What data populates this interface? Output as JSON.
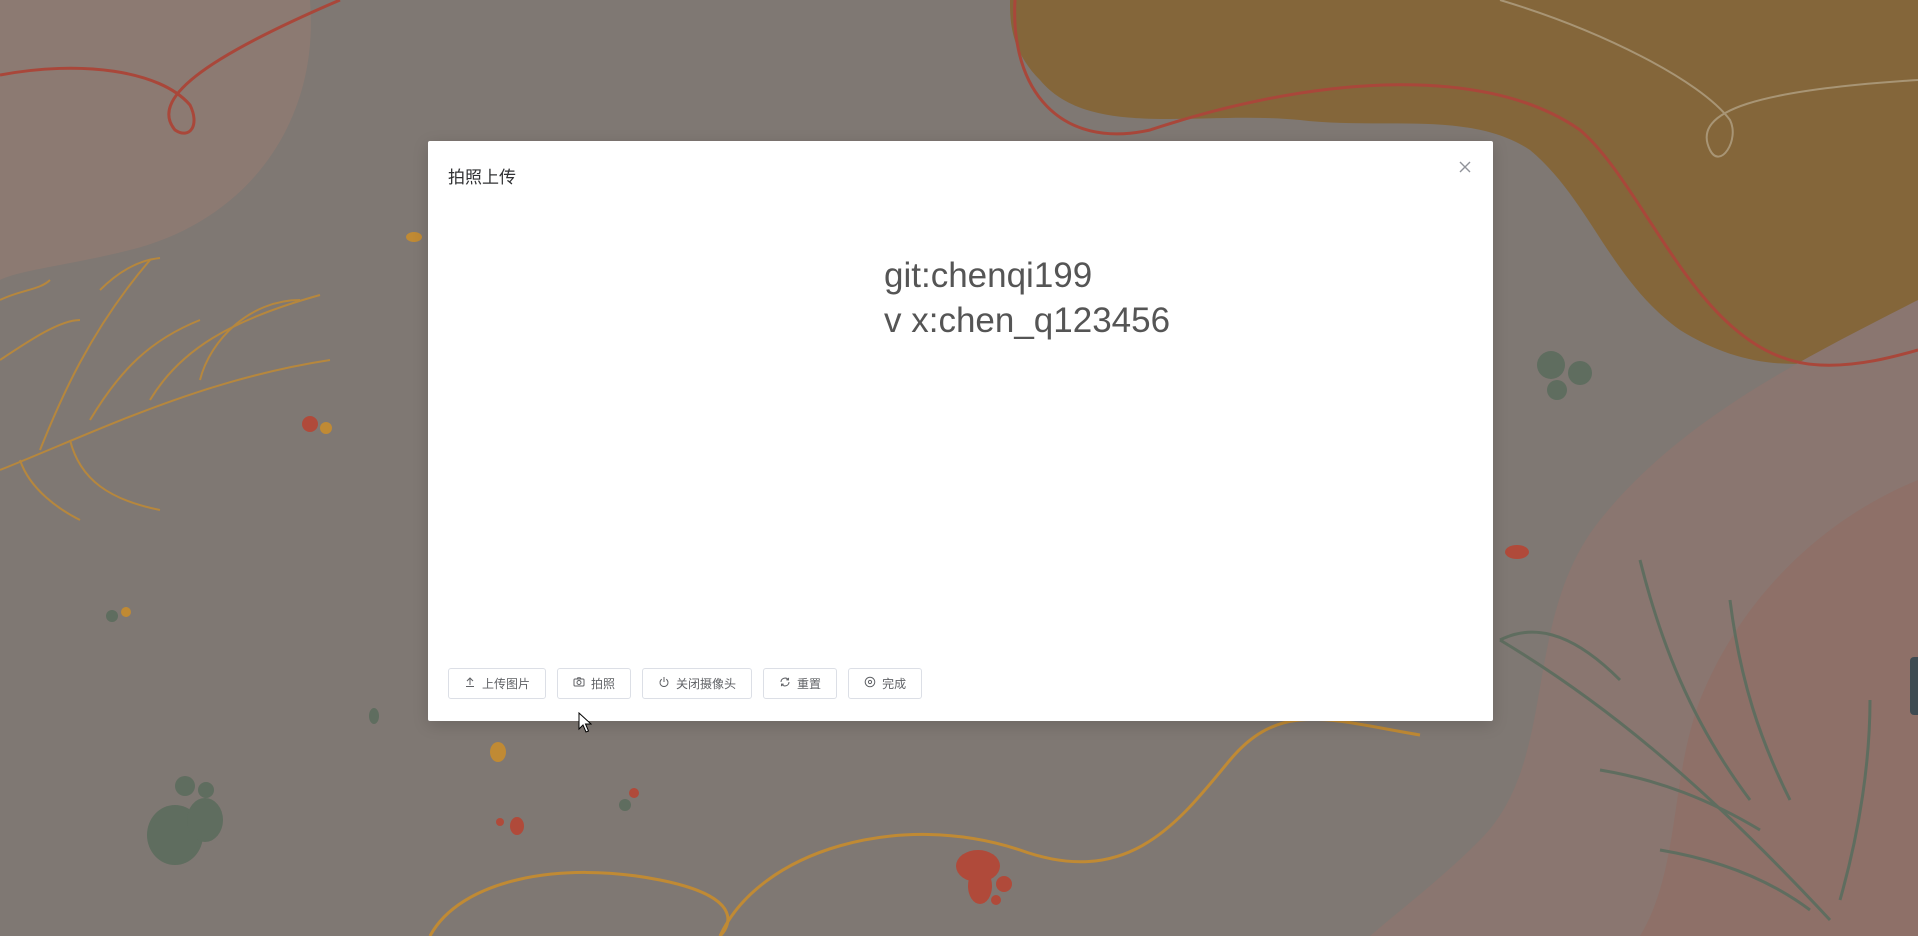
{
  "dialog": {
    "title": "拍照上传",
    "close_icon": "close-icon"
  },
  "watermark": {
    "line1": "git:chenqi199",
    "line2": "v x:chen_q123456"
  },
  "buttons": [
    {
      "label": "上传图片",
      "icon": "upload-icon"
    },
    {
      "label": "拍照",
      "icon": "camera-icon"
    },
    {
      "label": "关闭摄像头",
      "icon": "power-icon"
    },
    {
      "label": "重置",
      "icon": "refresh-icon"
    },
    {
      "label": "完成",
      "icon": "check-circle-icon"
    }
  ],
  "colors": {
    "background": "#7d7772",
    "modal": "#ffffff",
    "text_primary": "#303133",
    "button_text": "#606266",
    "button_border": "#dcdfe6"
  }
}
